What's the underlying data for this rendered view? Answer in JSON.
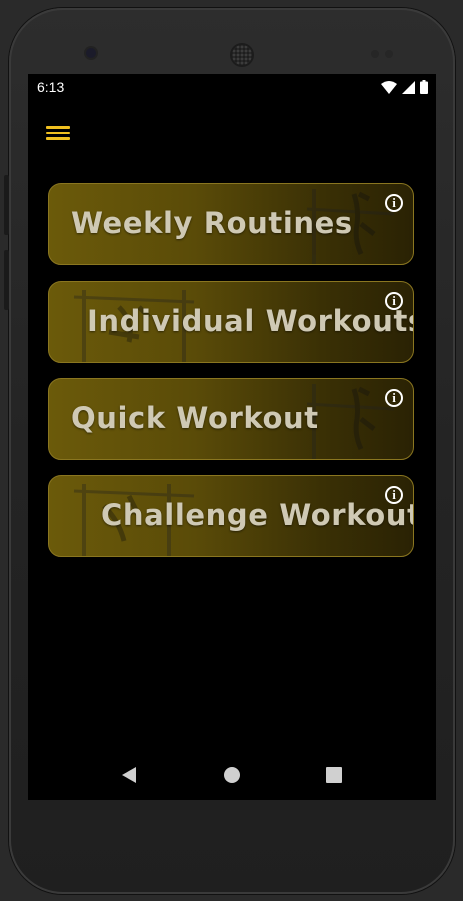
{
  "status_bar": {
    "time": "6:13",
    "icons": [
      "wifi-icon",
      "cell-signal-icon",
      "battery-icon"
    ]
  },
  "toolbar": {
    "menu_icon": "hamburger-menu-icon",
    "accent_color": "#f0c020"
  },
  "menu_cards": [
    {
      "label": "Weekly Routines",
      "info_icon": "info-icon"
    },
    {
      "label": "Individual Workouts",
      "info_icon": "info-icon"
    },
    {
      "label": "Quick Workout",
      "info_icon": "info-icon"
    },
    {
      "label": "Challenge Workout",
      "info_icon": "info-icon"
    }
  ],
  "nav_bar": {
    "back": "back-triangle-icon",
    "home": "home-circle-icon",
    "recents": "recents-square-icon"
  },
  "colors": {
    "card_gold": "#6b5a0a",
    "card_border": "#8a7620",
    "background": "#000000"
  }
}
